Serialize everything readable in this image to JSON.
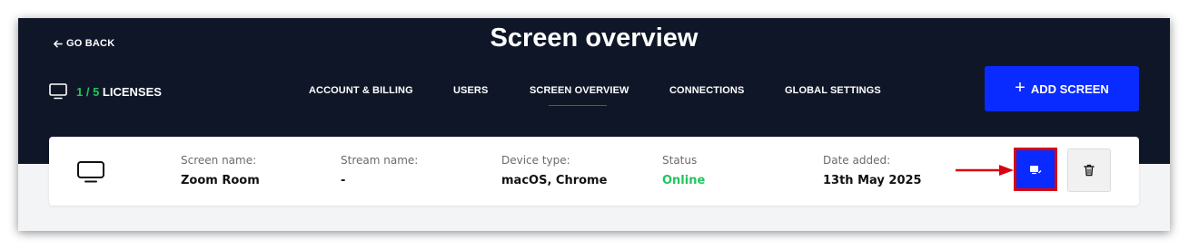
{
  "header": {
    "go_back_label": "GO BACK",
    "title": "Screen overview",
    "licenses": {
      "count": "1 / 5",
      "label": "LICENSES"
    },
    "tabs": [
      {
        "label": "ACCOUNT & BILLING"
      },
      {
        "label": "USERS"
      },
      {
        "label": "SCREEN OVERVIEW",
        "active": true
      },
      {
        "label": "CONNECTIONS"
      },
      {
        "label": "GLOBAL SETTINGS"
      }
    ],
    "add_button": {
      "icon": "plus-icon",
      "label": "ADD SCREEN"
    }
  },
  "screens": [
    {
      "icon": "monitor-icon",
      "fields": [
        {
          "label": "Screen name:",
          "value": "Zoom Room"
        },
        {
          "label": "Stream name:",
          "value": "-"
        },
        {
          "label": "Device type:",
          "value": "macOS, Chrome"
        },
        {
          "label": "Status",
          "value": "Online"
        },
        {
          "label": "Date added:",
          "value": "13th May 2025"
        }
      ],
      "actions": {
        "edit_icon": "edit-screen-icon",
        "delete_icon": "trash-icon"
      }
    }
  ],
  "colors": {
    "header_bg": "#0f1627",
    "accent_blue": "#0a2bff",
    "success_green": "#22c55e",
    "highlight_red": "#d90012"
  }
}
